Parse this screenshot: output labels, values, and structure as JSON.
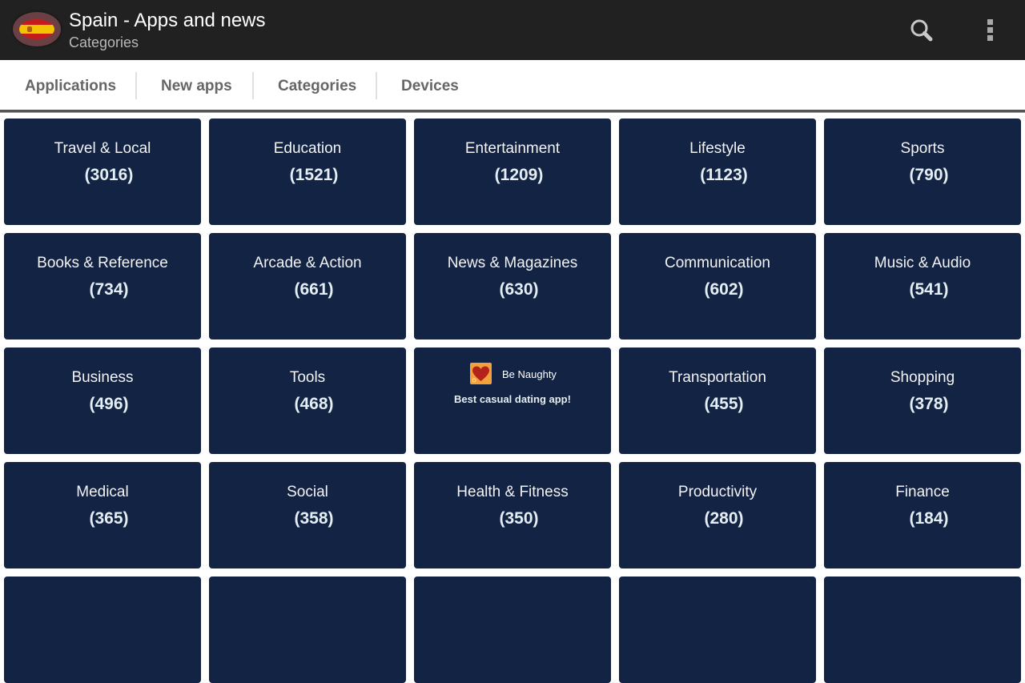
{
  "actionbar": {
    "title": "Spain - Apps and news",
    "subtitle": "Categories",
    "logo_icon": "spain-flag-icon",
    "search_icon": "search-icon",
    "menu_icon": "overflow-menu-icon"
  },
  "tabs": [
    {
      "label": "Applications"
    },
    {
      "label": "New apps"
    },
    {
      "label": "Categories",
      "selected": true
    },
    {
      "label": "Devices"
    }
  ],
  "categories": [
    {
      "name": "Travel & Local",
      "count": "(3016)"
    },
    {
      "name": "Education",
      "count": "(1521)"
    },
    {
      "name": "Entertainment",
      "count": "(1209)"
    },
    {
      "name": "Lifestyle",
      "count": "(1123)"
    },
    {
      "name": "Sports",
      "count": "(790)"
    },
    {
      "name": "Books & Reference",
      "count": "(734)"
    },
    {
      "name": "Arcade & Action",
      "count": "(661)"
    },
    {
      "name": "News & Magazines",
      "count": "(630)"
    },
    {
      "name": "Communication",
      "count": "(602)"
    },
    {
      "name": "Music & Audio",
      "count": "(541)"
    },
    {
      "name": "Business",
      "count": "(496)"
    },
    {
      "name": "Tools",
      "count": "(468)"
    },
    {
      "name": "Transportation",
      "count": "(455)"
    },
    {
      "name": "Shopping",
      "count": "(378)"
    },
    {
      "name": "Medical",
      "count": "(365)"
    },
    {
      "name": "Social",
      "count": "(358)"
    },
    {
      "name": "Health & Fitness",
      "count": "(350)"
    },
    {
      "name": "Productivity",
      "count": "(280)"
    },
    {
      "name": "Finance",
      "count": "(184)"
    }
  ],
  "ad": {
    "title": "Be Naughty",
    "text": "Best casual dating app!",
    "icon": "heart-app-icon"
  },
  "colors": {
    "tile_bg": "#132344",
    "actionbar_bg": "#212121",
    "tab_text": "#666666"
  }
}
